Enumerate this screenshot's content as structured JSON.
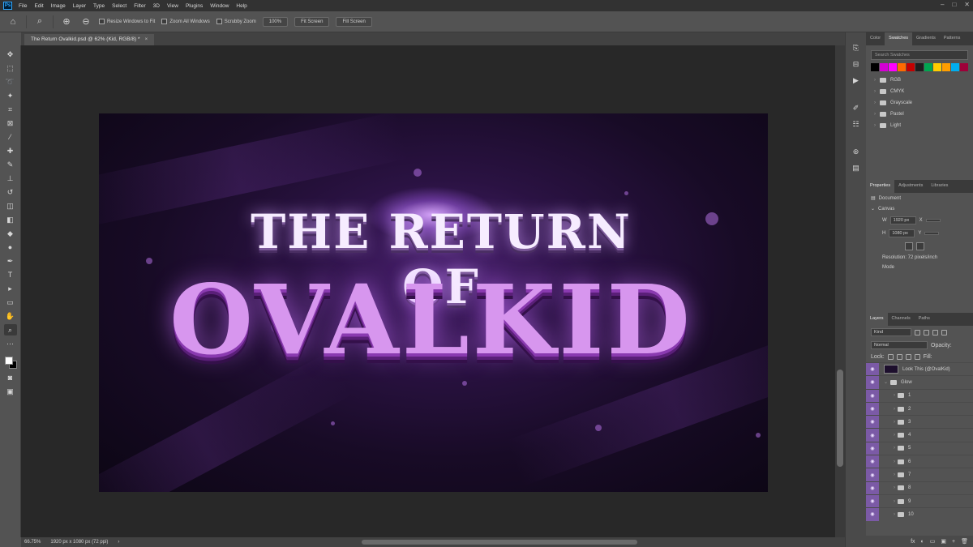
{
  "menubar": {
    "app_logo": "Ps",
    "items": [
      "File",
      "Edit",
      "Image",
      "Layer",
      "Type",
      "Select",
      "Filter",
      "3D",
      "View",
      "Plugins",
      "Window",
      "Help"
    ],
    "window_controls": [
      "–",
      "□",
      "✕"
    ]
  },
  "options": {
    "resize_windows": "Resize Windows to Fit",
    "zoom_all": "Zoom All Windows",
    "scrubby_zoom": "Scrubby Zoom",
    "btn_100": "100%",
    "btn_fit": "Fit Screen",
    "btn_fill": "Fill Screen"
  },
  "document": {
    "tab_title": "The Return Ovalkid.psd @ 62% (Kid, RGB/8) *",
    "close": "×"
  },
  "artwork": {
    "line1": "THE RETURN OF",
    "line2": "OVALKID"
  },
  "status": {
    "zoom": "66.75%",
    "doc_size": "1920 px x 1080 px (72 ppi)",
    "arrow": "›"
  },
  "swatches_panel": {
    "tabs": [
      "Color",
      "Swatches",
      "Gradients",
      "Patterns"
    ],
    "active_tab": "Swatches",
    "search_placeholder": "Search Swatches",
    "colors": [
      "#000000",
      "#d400d4",
      "#ff00ff",
      "#ff6a00",
      "#c30000",
      "#1e1e1e",
      "#00a651",
      "#ffcc00",
      "#ff9e00",
      "#00aeef",
      "#9e0039",
      "#8c63aa"
    ],
    "folders": [
      "RGB",
      "CMYK",
      "Grayscale",
      "Pastel",
      "Light"
    ]
  },
  "properties_panel": {
    "tabs": [
      "Properties",
      "Adjustments",
      "Libraries"
    ],
    "type_label": "Document",
    "section": "Canvas",
    "w_label": "W",
    "w_value": "1920 px",
    "h_label": "H",
    "h_value": "1080 px",
    "x_label": "X",
    "y_label": "Y",
    "resolution": "Resolution: 72 pixels/inch",
    "mode": "Mode"
  },
  "layers_panel": {
    "tabs": [
      "Layers",
      "Channels",
      "Paths"
    ],
    "kind": "Kind",
    "blend_mode": "Normal",
    "opacity_label": "Opacity:",
    "lock_label": "Lock:",
    "fill_label": "Fill:",
    "layers": [
      {
        "name": "Look This (@OvalKid)",
        "type": "image"
      },
      {
        "name": "Glow",
        "type": "group"
      },
      {
        "name": "1",
        "type": "group"
      },
      {
        "name": "2",
        "type": "group"
      },
      {
        "name": "3",
        "type": "group"
      },
      {
        "name": "4",
        "type": "group"
      },
      {
        "name": "5",
        "type": "group"
      },
      {
        "name": "6",
        "type": "group"
      },
      {
        "name": "7",
        "type": "group"
      },
      {
        "name": "8",
        "type": "group"
      },
      {
        "name": "9",
        "type": "group"
      },
      {
        "name": "10",
        "type": "group"
      }
    ],
    "bottom_icons": [
      "fx",
      "◐",
      "▭",
      "▣",
      "+",
      "🗑"
    ]
  },
  "accent": "#7b5aa6"
}
